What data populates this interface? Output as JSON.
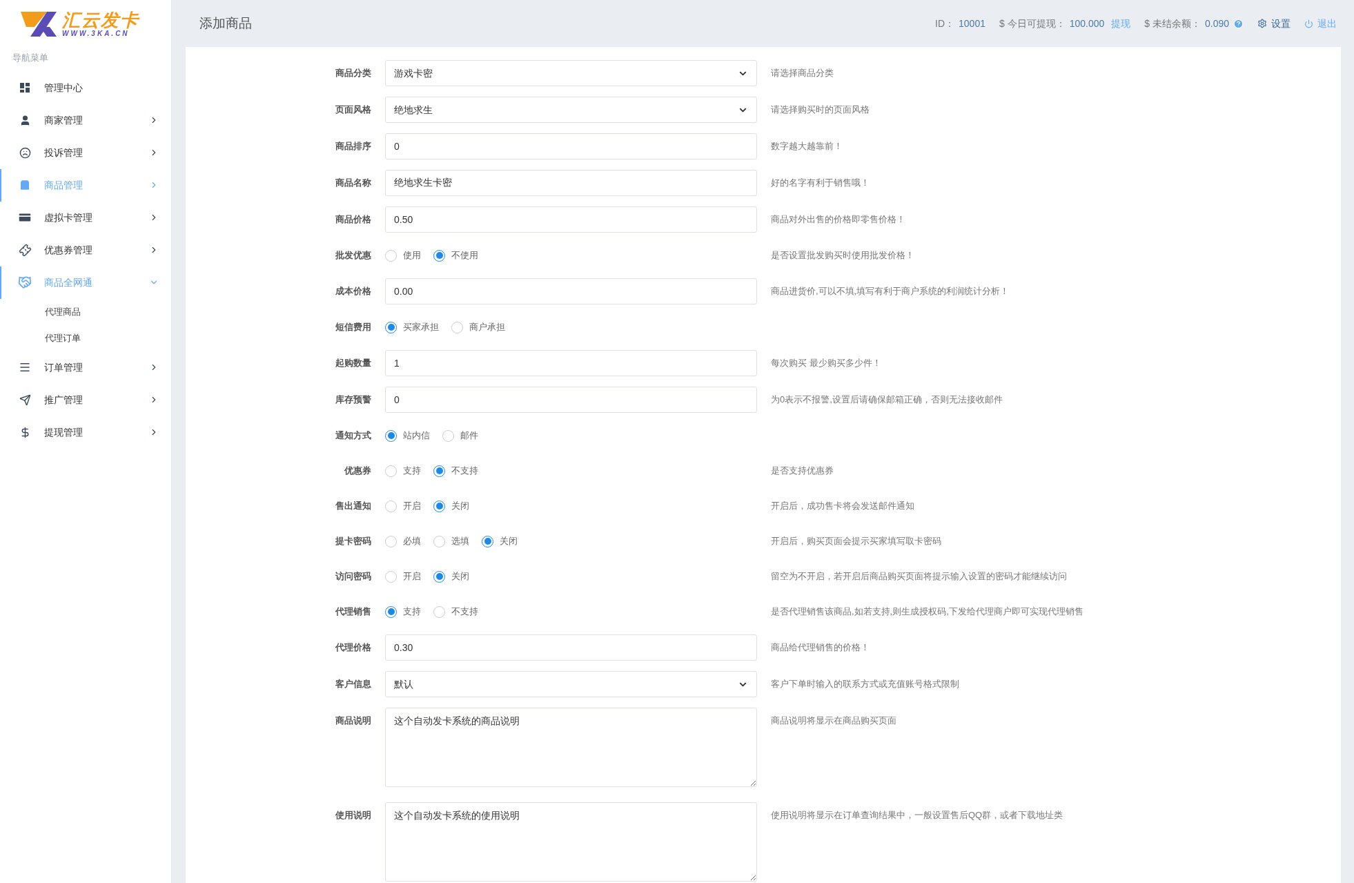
{
  "logo": {
    "name": "汇云发卡",
    "domain": "WWW.3KA.CN"
  },
  "sidebar": {
    "heading": "导航菜单",
    "items": [
      {
        "label": "管理中心",
        "kind": "link",
        "active": false,
        "expanded": false
      },
      {
        "label": "商家管理",
        "kind": "menu",
        "active": false,
        "expanded": false
      },
      {
        "label": "投诉管理",
        "kind": "menu",
        "active": false,
        "expanded": false
      },
      {
        "label": "商品管理",
        "kind": "menu",
        "active": true,
        "expanded": false
      },
      {
        "label": "虚拟卡管理",
        "kind": "menu",
        "active": false,
        "expanded": false
      },
      {
        "label": "优惠券管理",
        "kind": "menu",
        "active": false,
        "expanded": false
      },
      {
        "label": "商品全网通",
        "kind": "menu",
        "active": true,
        "expanded": true,
        "children": [
          {
            "label": "代理商品"
          },
          {
            "label": "代理订单"
          }
        ]
      },
      {
        "label": "订单管理",
        "kind": "menu",
        "active": false,
        "expanded": false
      },
      {
        "label": "推广管理",
        "kind": "menu",
        "active": false,
        "expanded": false
      },
      {
        "label": "提现管理",
        "kind": "menu",
        "active": false,
        "expanded": false
      }
    ]
  },
  "header": {
    "title": "添加商品",
    "id_label": "ID：",
    "id_value": "10001",
    "withdraw_label": "$ 今日可提现：",
    "withdraw_value": "100.000",
    "withdraw_link": "提现",
    "balance_label": "$ 未结余额：",
    "balance_value": "0.090",
    "settings": "设置",
    "logout": "退出"
  },
  "form": [
    {
      "kind": "select",
      "label": "商品分类",
      "value": "游戏卡密",
      "help": "请选择商品分类"
    },
    {
      "kind": "select",
      "label": "页面风格",
      "value": "绝地求生",
      "help": "请选择购买时的页面风格"
    },
    {
      "kind": "input",
      "label": "商品排序",
      "value": "0",
      "help": "数字越大越靠前！"
    },
    {
      "kind": "input",
      "label": "商品名称",
      "value": "绝地求生卡密",
      "help": "好的名字有利于销售哦！"
    },
    {
      "kind": "input",
      "label": "商品价格",
      "value": "0.50",
      "help": "商品对外出售的价格即零售价格！"
    },
    {
      "kind": "radio",
      "label": "批发优惠",
      "options": [
        {
          "label": "使用",
          "selected": false
        },
        {
          "label": "不使用",
          "selected": true
        }
      ],
      "help": "是否设置批发购买时使用批发价格！"
    },
    {
      "kind": "input",
      "label": "成本价格",
      "value": "0.00",
      "help": "商品进货价,可以不填,填写有利于商户系统的利润统计分析！"
    },
    {
      "kind": "radio",
      "label": "短信费用",
      "options": [
        {
          "label": "买家承担",
          "selected": true
        },
        {
          "label": "商户承担",
          "selected": false
        }
      ]
    },
    {
      "kind": "input",
      "label": "起购数量",
      "value": "1",
      "help": "每次购买 最少购买多少件！"
    },
    {
      "kind": "input",
      "label": "库存预警",
      "value": "0",
      "help": "为0表示不报警,设置后请确保邮箱正确，否则无法接收邮件"
    },
    {
      "kind": "radio",
      "label": "通知方式",
      "options": [
        {
          "label": "站内信",
          "selected": true
        },
        {
          "label": "邮件",
          "selected": false
        }
      ]
    },
    {
      "kind": "radio",
      "label": "优惠券",
      "options": [
        {
          "label": "支持",
          "selected": false
        },
        {
          "label": "不支持",
          "selected": true
        }
      ],
      "help": "是否支持优惠券"
    },
    {
      "kind": "radio",
      "label": "售出通知",
      "options": [
        {
          "label": "开启",
          "selected": false
        },
        {
          "label": "关闭",
          "selected": true
        }
      ],
      "help": "开启后，成功售卡将会发送邮件通知"
    },
    {
      "kind": "radio",
      "label": "提卡密码",
      "options": [
        {
          "label": "必填",
          "selected": false
        },
        {
          "label": "选填",
          "selected": false
        },
        {
          "label": "关闭",
          "selected": true
        }
      ],
      "help": "开启后，购买页面会提示买家填写取卡密码"
    },
    {
      "kind": "radio",
      "label": "访问密码",
      "options": [
        {
          "label": "开启",
          "selected": false
        },
        {
          "label": "关闭",
          "selected": true
        }
      ],
      "help": "留空为不开启，若开启后商品购买页面将提示输入设置的密码才能继续访问"
    },
    {
      "kind": "radio",
      "label": "代理销售",
      "options": [
        {
          "label": "支持",
          "selected": true
        },
        {
          "label": "不支持",
          "selected": false
        }
      ],
      "help": "是否代理销售该商品,如若支持,则生成授权码,下发给代理商户即可实现代理销售"
    },
    {
      "kind": "input",
      "label": "代理价格",
      "value": "0.30",
      "help": "商品给代理销售的价格！"
    },
    {
      "kind": "select",
      "label": "客户信息",
      "value": "默认",
      "help": "客户下单时输入的联系方式或充值账号格式限制"
    },
    {
      "kind": "textarea",
      "label": "商品说明",
      "value": "这个自动发卡系统的商品说明",
      "help": "商品说明将显示在商品购买页面"
    },
    {
      "kind": "textarea",
      "label": "使用说明",
      "value": "这个自动发卡系统的使用说明",
      "help": "使用说明将显示在订单查询结果中，一般设置售后QQ群，或者下载地址类"
    }
  ]
}
